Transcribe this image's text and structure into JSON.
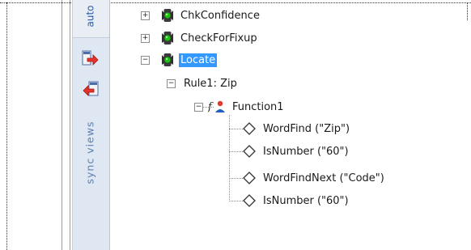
{
  "side_panel": {
    "tab_auto_label": "auto",
    "tab_sync_label": "sync views"
  },
  "tree": {
    "nodes": [
      {
        "label": "ChkConfidence",
        "expander": "+",
        "icon": "traffic-light-icon"
      },
      {
        "label": "CheckForFixup",
        "expander": "+",
        "icon": "traffic-light-icon"
      },
      {
        "label": "Locate",
        "expander": "−",
        "icon": "traffic-light-icon",
        "selected": true
      }
    ],
    "rule": {
      "label": "Rule1: Zip",
      "expander": "−"
    },
    "function": {
      "label": "Function1",
      "expander": "−",
      "icon": "function-icon"
    },
    "calls": [
      {
        "label": "WordFind (\"Zip\")",
        "icon": "diamond-icon"
      },
      {
        "label": "IsNumber (\"60\")",
        "icon": "diamond-icon"
      },
      {
        "label": "WordFindNext (\"Code\")",
        "icon": "diamond-icon"
      },
      {
        "label": "IsNumber (\"60\")",
        "icon": "diamond-icon"
      }
    ]
  },
  "colors": {
    "selection": "#3399ff",
    "strip_background": "#dfe7f2",
    "light_green": "#16c60c"
  }
}
